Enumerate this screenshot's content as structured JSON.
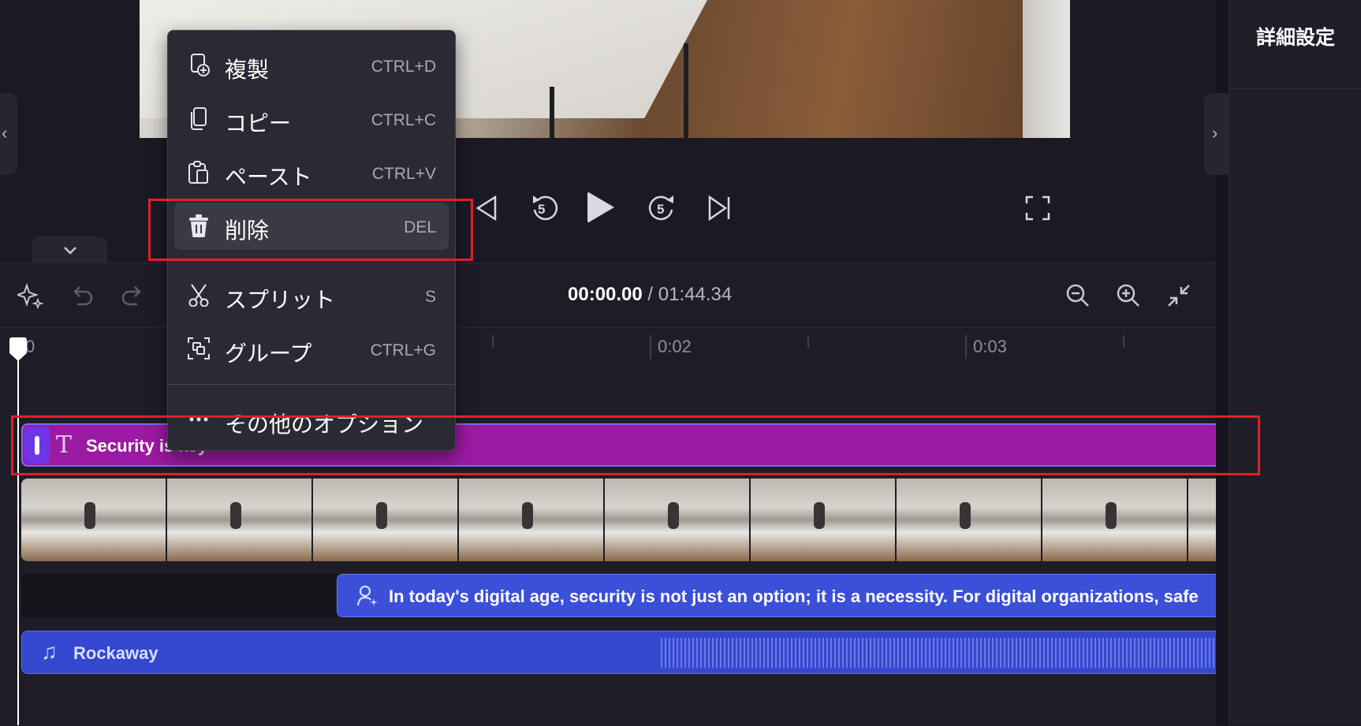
{
  "panel": {
    "title": "詳細設定"
  },
  "transport": {
    "rewind_label": "5",
    "forward_label": "5"
  },
  "timeline": {
    "current_time": "00:00.00",
    "separator": " / ",
    "total_time": "01:44.34",
    "ruler_labels": [
      "0",
      "0:02",
      "0:03"
    ]
  },
  "tracks": {
    "text_clip": "Security is key",
    "voice_clip": "In today's digital age, security is not just an option; it is a necessity. For digital organizations, safe",
    "music_clip": "Rockaway"
  },
  "context_menu": {
    "items": [
      {
        "label": "複製",
        "shortcut": "CTRL+D",
        "icon": "duplicate-icon"
      },
      {
        "label": "コピー",
        "shortcut": "CTRL+C",
        "icon": "copy-icon"
      },
      {
        "label": "ペースト",
        "shortcut": "CTRL+V",
        "icon": "paste-icon"
      },
      {
        "label": "削除",
        "shortcut": "DEL",
        "icon": "trash-icon"
      },
      {
        "label": "スプリット",
        "shortcut": "S",
        "icon": "scissors-icon"
      },
      {
        "label": "グループ",
        "shortcut": "CTRL+G",
        "icon": "group-icon"
      },
      {
        "label": "その他のオプション",
        "shortcut": "",
        "icon": "more-icon"
      }
    ]
  },
  "colors": {
    "text_clip": "#9b1aa3",
    "voice_clip": "#3b4fd8",
    "music_clip": "#3447cf",
    "highlight": "#e0202a"
  }
}
